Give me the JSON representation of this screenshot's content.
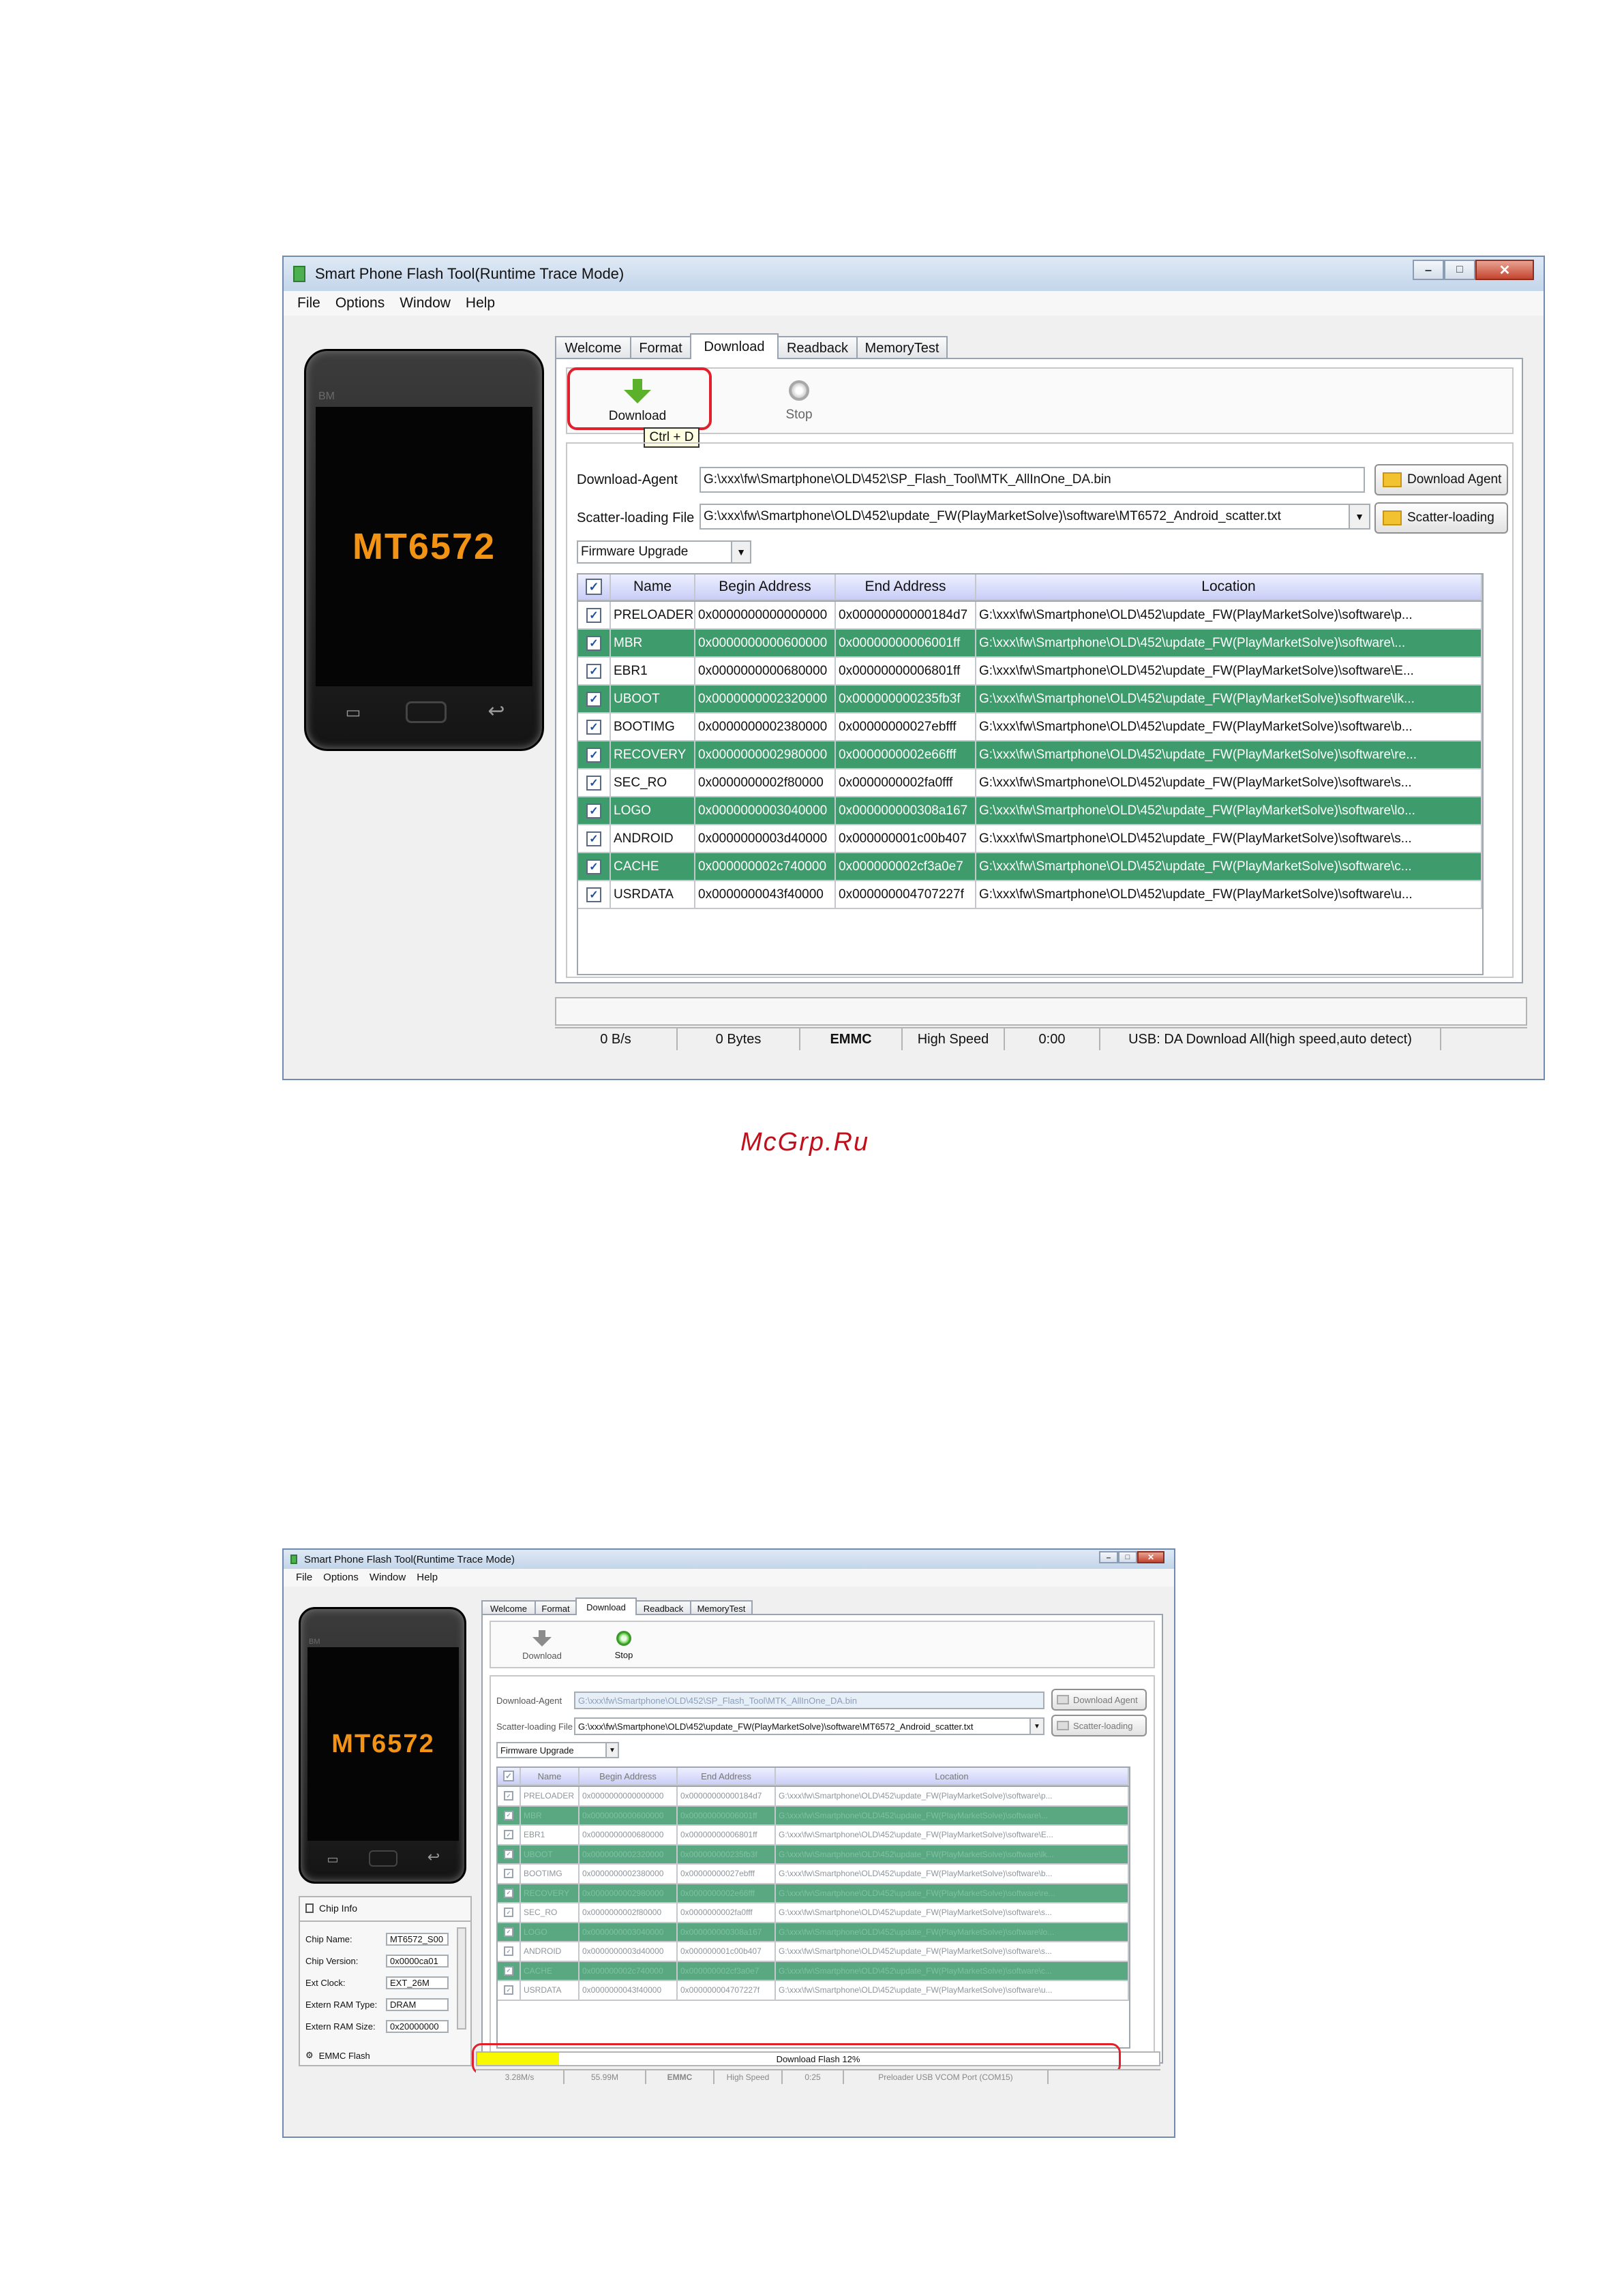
{
  "watermark": "McGrp.Ru",
  "screen1": {
    "title": "Smart Phone Flash Tool(Runtime Trace Mode)",
    "menu": [
      "File",
      "Options",
      "Window",
      "Help"
    ],
    "phone_brand": "BM",
    "chip": "MT6572",
    "tabs": [
      "Welcome",
      "Format",
      "Download",
      "Readback",
      "MemoryTest"
    ],
    "active_tab": "Download",
    "download_label": "Download",
    "stop_label": "Stop",
    "tooltip": "Ctrl + D",
    "download_agent_label": "Download-Agent",
    "download_agent_value": "G:\\xxx\\fw\\Smartphone\\OLD\\452\\SP_Flash_Tool\\MTK_AllInOne_DA.bin",
    "download_agent_button": "Download Agent",
    "scatter_label": "Scatter-loading File",
    "scatter_value": "G:\\xxx\\fw\\Smartphone\\OLD\\452\\update_FW(PlayMarketSolve)\\software\\MT6572_Android_scatter.txt",
    "scatter_button": "Scatter-loading",
    "mode_select": "Firmware Upgrade",
    "columns": [
      "Name",
      "Begin Address",
      "End Address",
      "Location"
    ],
    "rows": [
      {
        "name": "PRELOADER",
        "begin": "0x0000000000000000",
        "end": "0x00000000000184d7",
        "loc": "G:\\xxx\\fw\\Smartphone\\OLD\\452\\update_FW(PlayMarketSolve)\\software\\p..."
      },
      {
        "name": "MBR",
        "begin": "0x0000000000600000",
        "end": "0x00000000006001ff",
        "loc": "G:\\xxx\\fw\\Smartphone\\OLD\\452\\update_FW(PlayMarketSolve)\\software\\..."
      },
      {
        "name": "EBR1",
        "begin": "0x0000000000680000",
        "end": "0x00000000006801ff",
        "loc": "G:\\xxx\\fw\\Smartphone\\OLD\\452\\update_FW(PlayMarketSolve)\\software\\E..."
      },
      {
        "name": "UBOOT",
        "begin": "0x0000000002320000",
        "end": "0x000000000235fb3f",
        "loc": "G:\\xxx\\fw\\Smartphone\\OLD\\452\\update_FW(PlayMarketSolve)\\software\\lk..."
      },
      {
        "name": "BOOTIMG",
        "begin": "0x0000000002380000",
        "end": "0x00000000027ebfff",
        "loc": "G:\\xxx\\fw\\Smartphone\\OLD\\452\\update_FW(PlayMarketSolve)\\software\\b..."
      },
      {
        "name": "RECOVERY",
        "begin": "0x0000000002980000",
        "end": "0x0000000002e66fff",
        "loc": "G:\\xxx\\fw\\Smartphone\\OLD\\452\\update_FW(PlayMarketSolve)\\software\\re..."
      },
      {
        "name": "SEC_RO",
        "begin": "0x0000000002f80000",
        "end": "0x0000000002fa0fff",
        "loc": "G:\\xxx\\fw\\Smartphone\\OLD\\452\\update_FW(PlayMarketSolve)\\software\\s..."
      },
      {
        "name": "LOGO",
        "begin": "0x0000000003040000",
        "end": "0x000000000308a167",
        "loc": "G:\\xxx\\fw\\Smartphone\\OLD\\452\\update_FW(PlayMarketSolve)\\software\\lo..."
      },
      {
        "name": "ANDROID",
        "begin": "0x0000000003d40000",
        "end": "0x000000001c00b407",
        "loc": "G:\\xxx\\fw\\Smartphone\\OLD\\452\\update_FW(PlayMarketSolve)\\software\\s..."
      },
      {
        "name": "CACHE",
        "begin": "0x000000002c740000",
        "end": "0x000000002cf3a0e7",
        "loc": "G:\\xxx\\fw\\Smartphone\\OLD\\452\\update_FW(PlayMarketSolve)\\software\\c..."
      },
      {
        "name": "USRDATA",
        "begin": "0x0000000043f40000",
        "end": "0x000000004707227f",
        "loc": "G:\\xxx\\fw\\Smartphone\\OLD\\452\\update_FW(PlayMarketSolve)\\software\\u..."
      }
    ],
    "status": [
      "0 B/s",
      "0 Bytes",
      "EMMC",
      "High Speed",
      "0:00",
      "USB: DA Download All(high speed,auto detect)"
    ]
  },
  "screen2": {
    "title": "Smart Phone Flash Tool(Runtime Trace Mode)",
    "menu": [
      "File",
      "Options",
      "Window",
      "Help"
    ],
    "phone_brand": "BM",
    "chip": "MT6572",
    "tabs": [
      "Welcome",
      "Format",
      "Download",
      "Readback",
      "MemoryTest"
    ],
    "download_label": "Download",
    "stop_label": "Stop",
    "download_agent_label": "Download-Agent",
    "download_agent_value": "G:\\xxx\\fw\\Smartphone\\OLD\\452\\SP_Flash_Tool\\MTK_AllInOne_DA.bin",
    "download_agent_button": "Download Agent",
    "scatter_label": "Scatter-loading File",
    "scatter_value": "G:\\xxx\\fw\\Smartphone\\OLD\\452\\update_FW(PlayMarketSolve)\\software\\MT6572_Android_scatter.txt",
    "scatter_button": "Scatter-loading",
    "mode_select": "Firmware Upgrade",
    "columns": [
      "Name",
      "Begin Address",
      "End Address",
      "Location"
    ],
    "chip_info_title": "Chip Info",
    "chip_info": [
      {
        "label": "Chip Name:",
        "value": "MT6572_S00"
      },
      {
        "label": "Chip Version:",
        "value": "0x0000ca01"
      },
      {
        "label": "Ext Clock:",
        "value": "EXT_26M"
      },
      {
        "label": "Extern RAM Type:",
        "value": "DRAM"
      },
      {
        "label": "Extern RAM Size:",
        "value": "0x20000000"
      }
    ],
    "emmc_flash": "EMMC Flash",
    "progress_text": "Download Flash 12%",
    "progress_percent": 12,
    "status": [
      "3.28M/s",
      "55.99M",
      "EMMC",
      "High Speed",
      "0:25",
      "Preloader USB VCOM Port (COM15)"
    ]
  }
}
